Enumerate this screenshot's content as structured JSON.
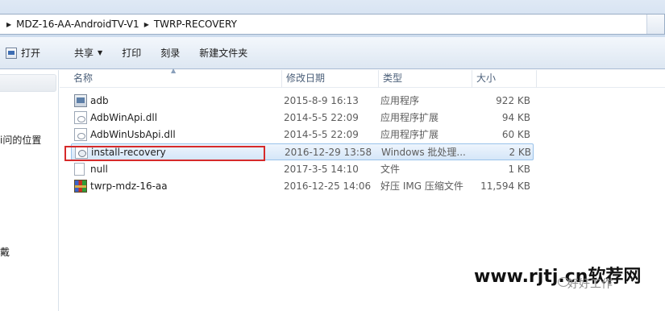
{
  "address_bar": {
    "breadcrumbs": [
      "MDZ-16-AA-AndroidTV-V1",
      "TWRP-RECOVERY"
    ]
  },
  "toolbar": {
    "open_label": "打开",
    "share_label": "共享",
    "print_label": "打印",
    "burn_label": "刻录",
    "new_folder_label": "新建文件夹"
  },
  "nav": {
    "item1_partial": "i问的位置",
    "item2_partial": "戴"
  },
  "columns": {
    "name": "名称",
    "date": "修改日期",
    "type": "类型",
    "size": "大小"
  },
  "files": [
    {
      "name": "adb",
      "date": "2015-8-9 16:13",
      "type": "应用程序",
      "size": "922 KB",
      "icon": "exe-icon"
    },
    {
      "name": "AdbWinApi.dll",
      "date": "2014-5-5 22:09",
      "type": "应用程序扩展",
      "size": "94 KB",
      "icon": "dll-icon"
    },
    {
      "name": "AdbWinUsbApi.dll",
      "date": "2014-5-5 22:09",
      "type": "应用程序扩展",
      "size": "60 KB",
      "icon": "dll-icon"
    },
    {
      "name": "install-recovery",
      "date": "2016-12-29 13:58",
      "type": "Windows 批处理...",
      "size": "2 KB",
      "icon": "batch-file-icon",
      "selected": true
    },
    {
      "name": "null",
      "date": "2017-3-5 14:10",
      "type": "文件",
      "size": "1 KB",
      "icon": "file-icon"
    },
    {
      "name": "twrp-mdz-16-aa",
      "date": "2016-12-25 14:06",
      "type": "好压 IMG 压缩文件",
      "size": "11,594 KB",
      "icon": "archive-icon"
    }
  ],
  "watermark": {
    "main": "www.rjtj.cn软荐网",
    "sub": "好好工作"
  },
  "colors": {
    "highlight_box": "#d62a2a",
    "selection_fill": "#d5e6f8",
    "toolbar_bg": "#dde7f2"
  }
}
